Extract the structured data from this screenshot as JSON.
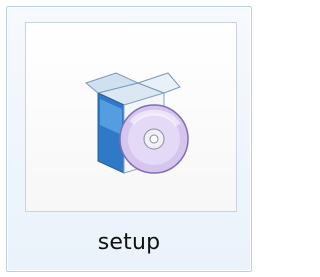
{
  "item": {
    "label": "setup",
    "icon": "setup-installer-icon"
  },
  "colors": {
    "selection_border": "#b9d0e7",
    "selection_fill": "#eaf2fb",
    "box_blue": "#3f8fd6",
    "disc": "#d7c7ef"
  }
}
